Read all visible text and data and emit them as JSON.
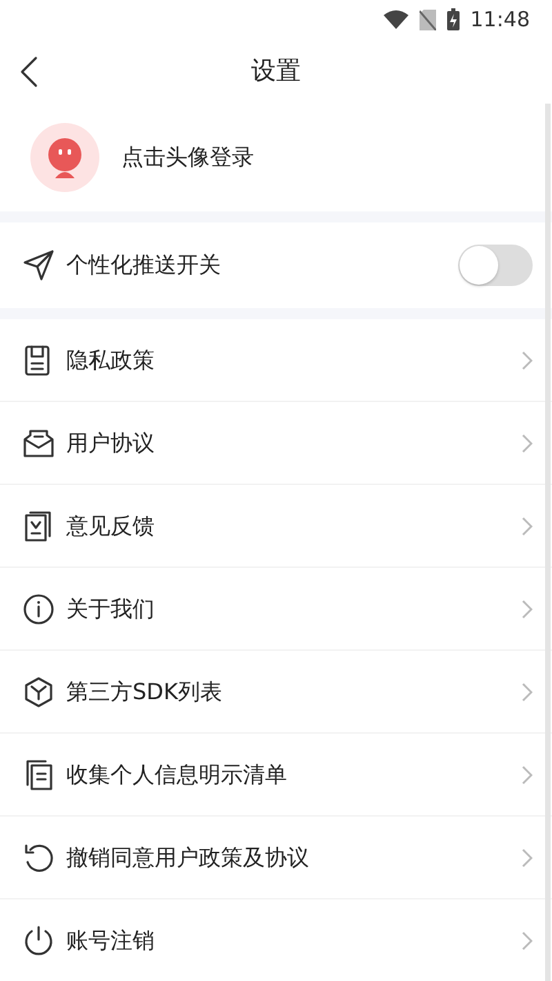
{
  "status_bar": {
    "time": "11:48"
  },
  "header": {
    "title": "设置"
  },
  "profile": {
    "label": "点击头像登录"
  },
  "push_toggle": {
    "label": "个性化推送开关",
    "on": false
  },
  "menu_items": [
    {
      "label": "隐私政策"
    },
    {
      "label": "用户协议"
    },
    {
      "label": "意见反馈"
    },
    {
      "label": "关于我们"
    },
    {
      "label": "第三方SDK列表"
    },
    {
      "label": "收集个人信息明示清单"
    },
    {
      "label": "撤销同意用户政策及协议"
    },
    {
      "label": "账号注销"
    }
  ]
}
